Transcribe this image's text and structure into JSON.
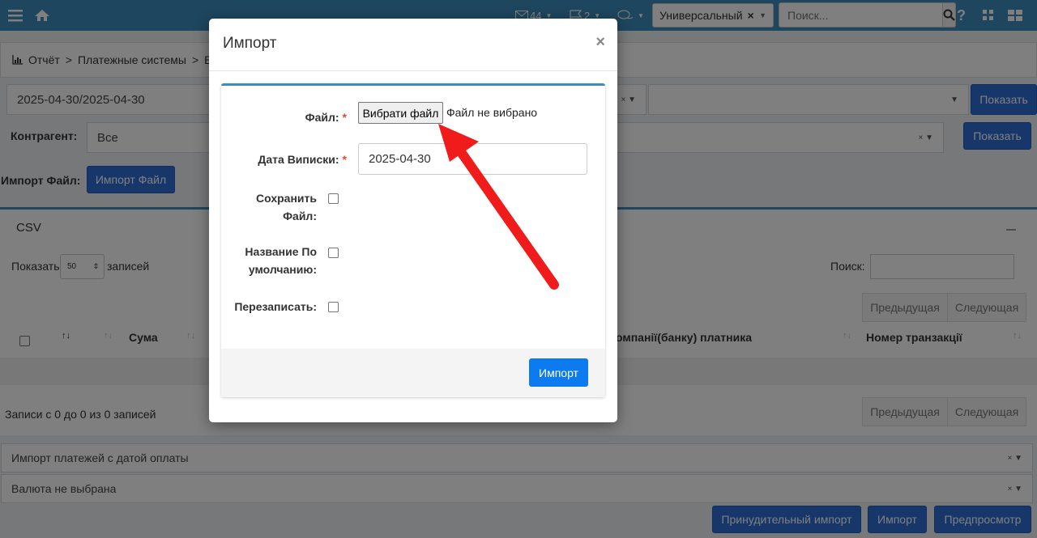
{
  "navbar": {
    "mail_count": "44",
    "flag_count": "2",
    "universal_label": "Универсальный",
    "search_placeholder": "Поиск..."
  },
  "breadcrumb": {
    "root": "Отчёт",
    "sep": ">",
    "level2": "Платежные системы",
    "level3": "Вну"
  },
  "filters": {
    "date_range": "2025-04-30/2025-04-30",
    "show_label": "Показать",
    "contractor_label": "Контрагент:",
    "contractor_value": "Все",
    "import_file_label": "Импорт Файл:",
    "import_file_button": "Импорт Файл"
  },
  "csv": {
    "title": "CSV",
    "show_label": "Показать",
    "page_size": "50",
    "records_label": "записей",
    "search_label": "Поиск:",
    "prev": "Предыдущая",
    "next": "Следующая",
    "col_sum": "Сума",
    "col_bank": "омпанії(банку) платника",
    "col_txn": "Номер транзакції",
    "info": "Записи с 0 до 0 из 0 записей"
  },
  "bottom": {
    "select1": "Импорт платежей с датой оплаты",
    "select2": "Валюта не выбрана",
    "forced_import": "Принудительный импорт",
    "import": "Импорт",
    "preview": "Предпросмотр"
  },
  "modal": {
    "title": "Импорт",
    "close": "×",
    "file_label": "Файл:",
    "file_button": "Вибрати файл",
    "file_status": "Файл не вибрано",
    "date_label": "Дата Виписки:",
    "date_value": "2025-04-30",
    "save_label_1": "Сохранить",
    "save_label_2": "Файл:",
    "default_name_1": "Название По",
    "default_name_2": "умолчанию:",
    "overwrite_label": "Перезаписать:",
    "required_mark": "*",
    "submit": "Импорт"
  },
  "colors": {
    "navbar": "#3c8dbc",
    "primary_button": "#0d7bf0",
    "annotation_arrow": "#f01c1c"
  }
}
